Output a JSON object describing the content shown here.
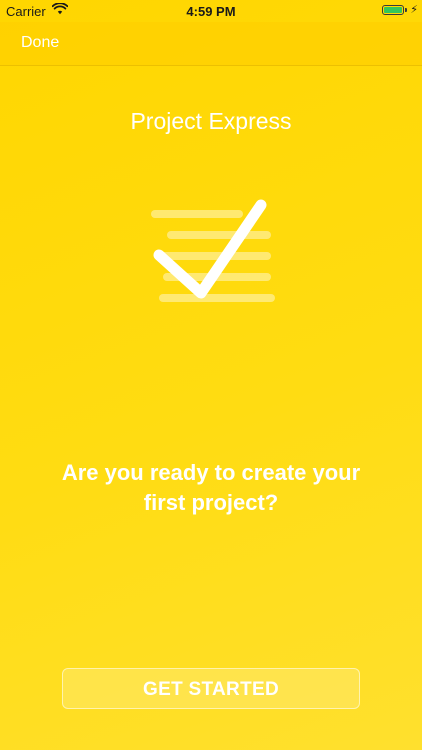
{
  "status_bar": {
    "carrier": "Carrier",
    "time": "4:59 PM",
    "wifi_icon": "wifi-icon",
    "battery_icon": "battery-icon",
    "charging_icon": "charging-bolt-icon",
    "battery_level": 1.0
  },
  "nav": {
    "done_label": "Done"
  },
  "app": {
    "title": "Project Express",
    "logo_icon": "checklist-checkmark-icon"
  },
  "prompt": {
    "text": "Are you ready to create your first project?"
  },
  "actions": {
    "get_started_label": "GET STARTED"
  },
  "colors": {
    "background": "#FFD600",
    "text": "#FFFFFF",
    "battery": "#34C759"
  }
}
